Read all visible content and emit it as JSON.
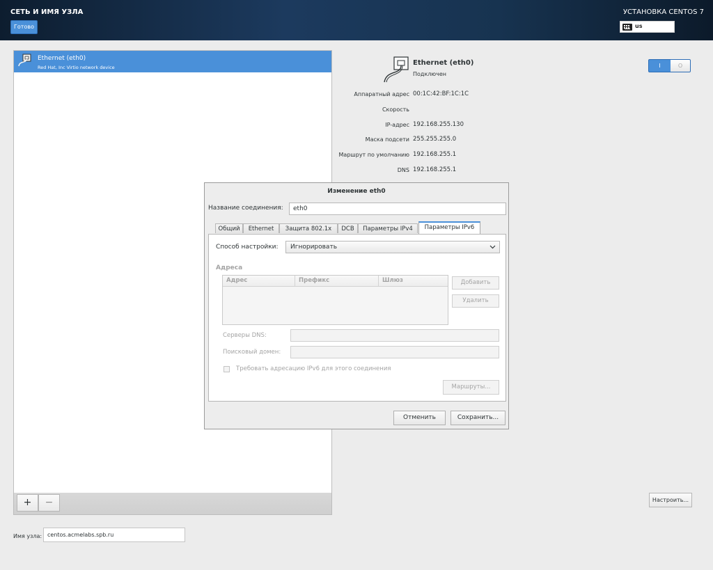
{
  "header": {
    "title": "СЕТЬ И ИМЯ УЗЛА",
    "done_label": "Готово",
    "install_title": "УСТАНОВКА CENTOS 7",
    "keyboard_layout": "us"
  },
  "devices": {
    "items": [
      {
        "name": "Ethernet (eth0)",
        "description": "Red Hat, Inc Virtio network device"
      }
    ],
    "add_label": "+",
    "remove_label": "−"
  },
  "hostname": {
    "label": "Имя узла:",
    "value": "centos.acmelabs.spb.ru"
  },
  "details": {
    "name": "Ethernet (eth0)",
    "status": "Подключен",
    "rows": [
      {
        "label": "Аппаратный адрес",
        "value": "00:1C:42:BF:1C:1C"
      },
      {
        "label": "Скорость",
        "value": ""
      },
      {
        "label": "IP-адрес",
        "value": "192.168.255.130"
      },
      {
        "label": "Маска подсети",
        "value": "255.255.255.0"
      },
      {
        "label": "Маршрут по умолчанию",
        "value": "192.168.255.1"
      },
      {
        "label": "DNS",
        "value": "192.168.255.1"
      }
    ],
    "toggle_on_label": "I",
    "toggle_off_label": "O",
    "configure_label": "Настроить..."
  },
  "dialog": {
    "title": "Изменение eth0",
    "conn_name_label": "Название соединения:",
    "conn_name_value": "eth0",
    "tabs": [
      "Общий",
      "Ethernet",
      "Защита 802.1x",
      "DCB",
      "Параметры IPv4",
      "Параметры IPv6"
    ],
    "method_label": "Способ настройки:",
    "method_value": "Игнорировать",
    "addresses_title": "Адреса",
    "columns": [
      "Адрес",
      "Префикс",
      "Шлюз"
    ],
    "add_label": "Добавить",
    "delete_label": "Удалить",
    "dns_label": "Серверы DNS:",
    "search_label": "Поисковый домен:",
    "require_label": "Требовать адресацию IPv6 для этого соединения",
    "routes_label": "Маршруты...",
    "cancel_label": "Отменить",
    "save_label": "Сохранить..."
  }
}
